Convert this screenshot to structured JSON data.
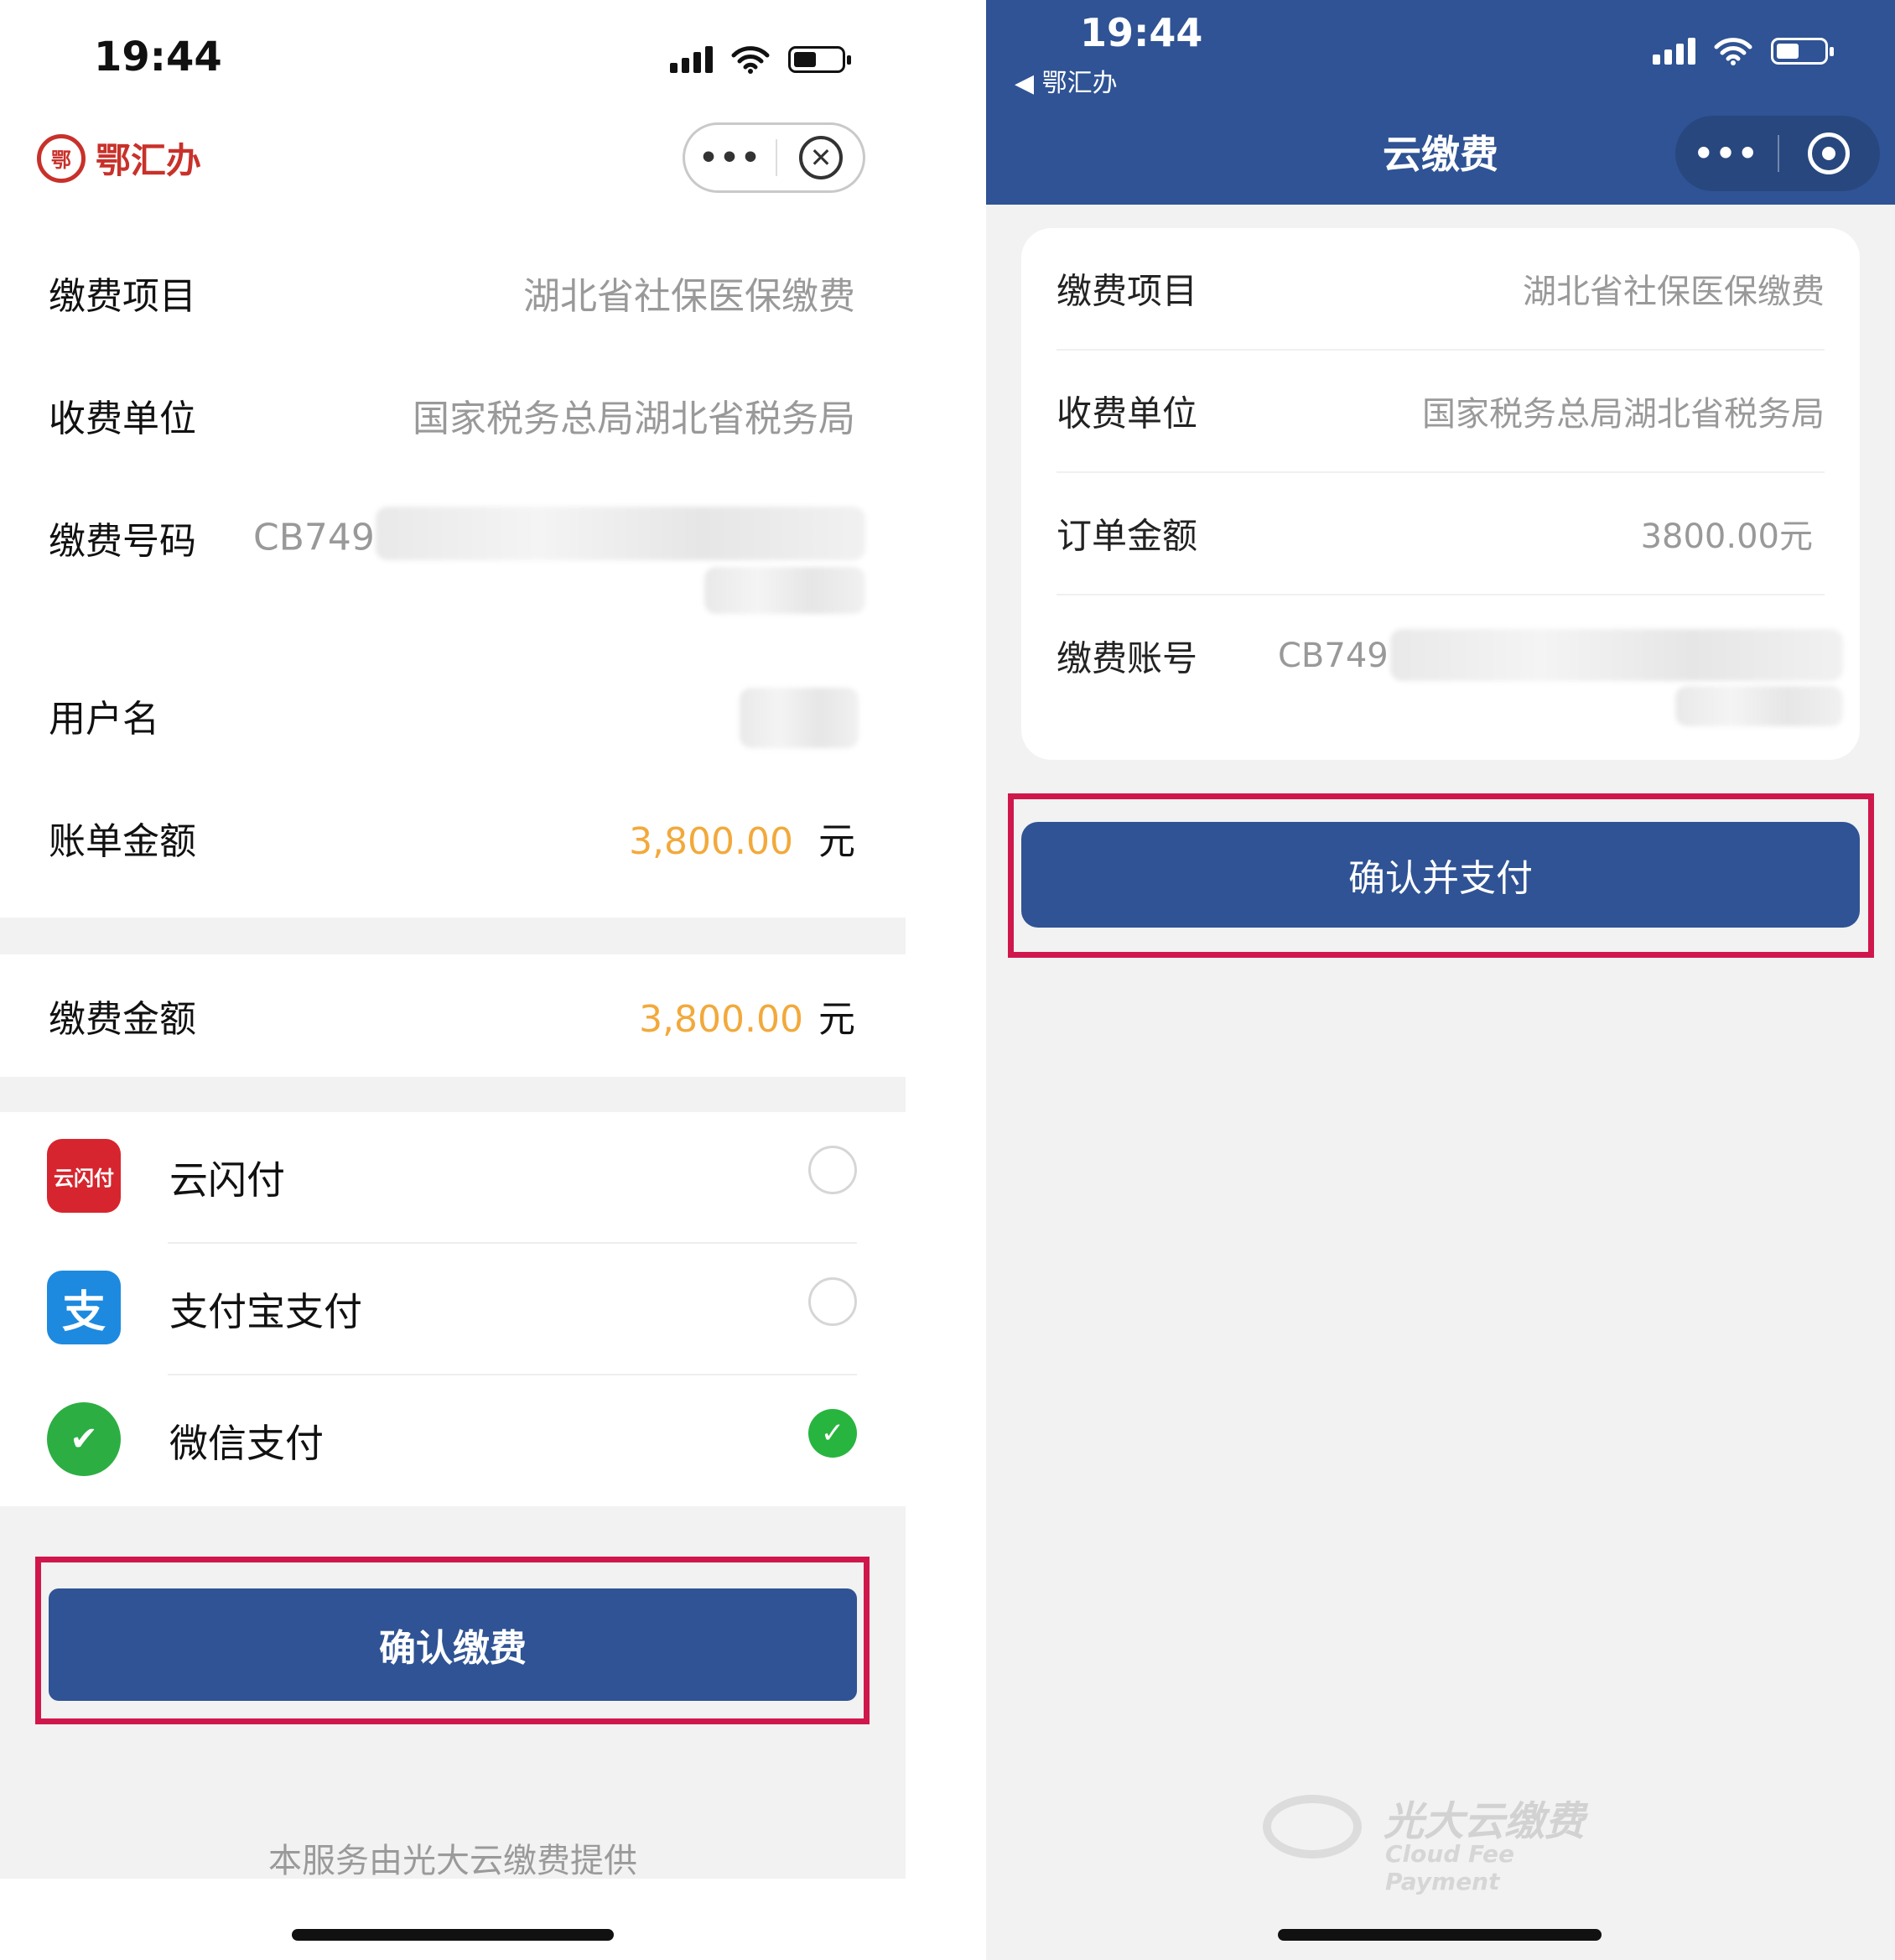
{
  "left": {
    "status_time": "19:44",
    "brand_name": "鄂汇办",
    "brand_emblem": "鄂",
    "capsule_more": "•••",
    "capsule_close": "✕",
    "rows": {
      "item_label": "缴费项目",
      "item_value": "湖北省社保医保缴费",
      "unit_label": "收费单位",
      "unit_value": "国家税务总局湖北省税务局",
      "number_label": "缴费号码",
      "number_value": "CB749",
      "user_label": "用户名",
      "bill_label": "账单金额",
      "bill_amount": "3,800.00",
      "bill_unit": "元"
    },
    "pay_amount": {
      "label": "缴费金额",
      "amount": "3,800.00",
      "unit": "元"
    },
    "payment_methods": [
      {
        "name": "云闪付",
        "icon": "unionpay-icon",
        "icon_text": "云闪付",
        "selected": false
      },
      {
        "name": "支付宝支付",
        "icon": "alipay-icon",
        "icon_text": "支",
        "selected": false
      },
      {
        "name": "微信支付",
        "icon": "wechat-pay-icon",
        "icon_text": "✔",
        "selected": true
      }
    ],
    "selected_check": "✓",
    "confirm_button": "确认缴费",
    "footer_note": "本服务由光大云缴费提供"
  },
  "right": {
    "status_time": "19:44",
    "back_label": "◀ 鄂汇办",
    "title": "云缴费",
    "capsule_more": "•••",
    "rows": {
      "item_label": "缴费项目",
      "item_value": "湖北省社保医保缴费",
      "unit_label": "收费单位",
      "unit_value": "国家税务总局湖北省税务局",
      "order_label": "订单金额",
      "order_value": "3800.00元",
      "account_label": "缴费账号",
      "account_value": "CB749"
    },
    "confirm_button": "确认并支付",
    "logo_cn": "光大云缴费",
    "logo_en": "Cloud Fee Payment"
  },
  "colors": {
    "brand_blue": "#2f5394",
    "amount_orange": "#f2a93b",
    "highlight_red": "#d0174c",
    "success_green": "#28b53f",
    "brand_red": "#c8312a"
  }
}
